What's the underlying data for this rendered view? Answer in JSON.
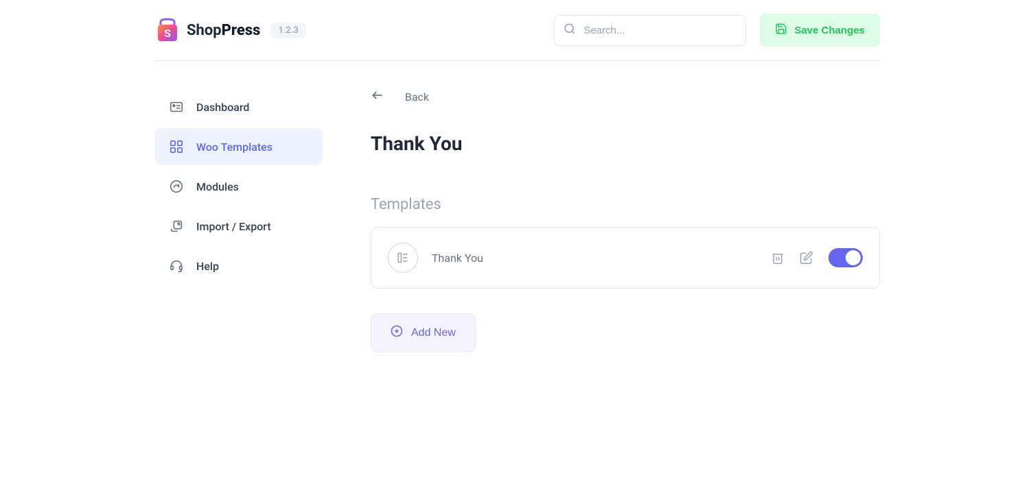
{
  "brand": {
    "name_first": "Shop",
    "name_second": "Press",
    "version": "1.2.3"
  },
  "header": {
    "search_placeholder": "Search...",
    "save_label": "Save Changes"
  },
  "sidebar": {
    "items": [
      {
        "label": "Dashboard"
      },
      {
        "label": "Woo Templates"
      },
      {
        "label": "Modules"
      },
      {
        "label": "Import / Export"
      },
      {
        "label": "Help"
      }
    ]
  },
  "content": {
    "back_label": "Back",
    "page_title": "Thank You",
    "section_title": "Templates",
    "templates": [
      {
        "name": "Thank You",
        "enabled": true
      }
    ],
    "add_new_label": "Add New"
  }
}
